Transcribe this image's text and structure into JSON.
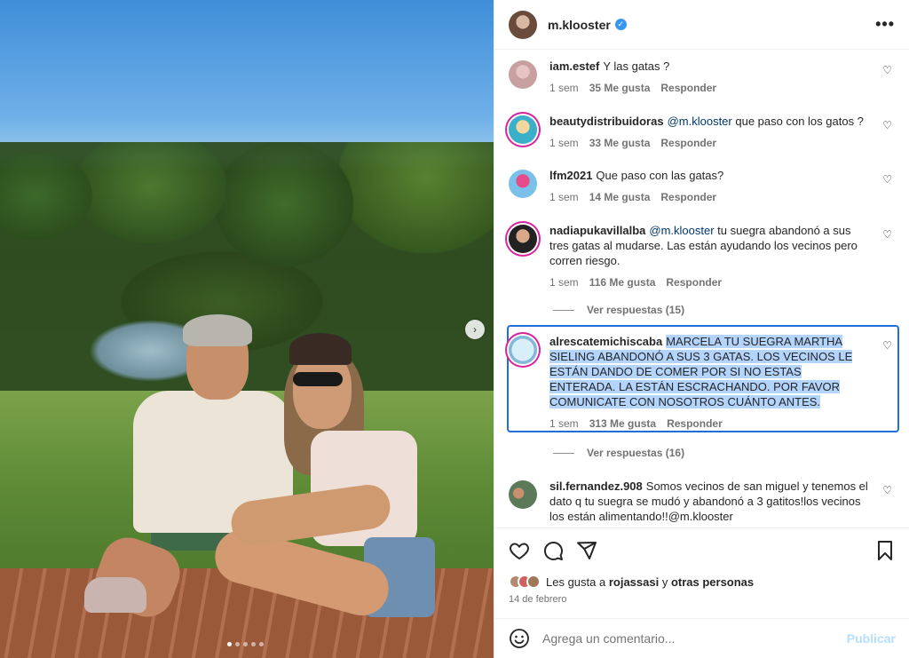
{
  "post": {
    "username": "m.klooster",
    "more_label": "•••",
    "next_label": "›"
  },
  "comments": [
    {
      "user": "iam.estef",
      "text": "Y las gatas ?",
      "time": "1 sem",
      "likes": "35 Me gusta",
      "reply": "Responder"
    },
    {
      "user": "beautydistribuidoras",
      "mention": "@m.klooster",
      "text": " que paso con los gatos ?",
      "time": "1 sem",
      "likes": "33 Me gusta",
      "reply": "Responder"
    },
    {
      "user": "lfm2021",
      "text": "Que paso con las gatas?",
      "time": "1 sem",
      "likes": "14 Me gusta",
      "reply": "Responder"
    },
    {
      "user": "nadiapukavillalba",
      "mention": "@m.klooster",
      "text": " tu suegra abandonó a sus tres gatas al mudarse. Las están ayudando los vecinos pero corren riesgo.",
      "time": "1 sem",
      "likes": "116 Me gusta",
      "reply": "Responder",
      "replies": "Ver respuestas (15)"
    },
    {
      "user": "alrescatemichiscaba",
      "text": "MARCELA TU SUEGRA MARTHA SIELING ABANDONÓ A SUS 3 GATAS. LOS VECINOS LE ESTÁN DANDO DE COMER POR SI NO ESTAS ENTERADA. LA ESTÁN ESCRACHANDO. POR FAVOR COMUNICATE CON NOSOTROS CUÁNTO ANTES.",
      "time": "1 sem",
      "likes": "313 Me gusta",
      "reply": "Responder",
      "replies": "Ver respuestas (16)"
    },
    {
      "user": "sil.fernandez.908",
      "text": "Somos vecinos de san miguel y tenemos el dato q tu suegra se mudó y abandonó a 3 gatitos!los vecinos los están alimentando!!@m.klooster"
    }
  ],
  "likes_bar": {
    "prefix": "Les gusta a ",
    "liker": "rojassasi",
    "middle": " y ",
    "others": "otras personas"
  },
  "date": "14 de febrero",
  "composer": {
    "placeholder": "Agrega un comentario...",
    "publish": "Publicar"
  },
  "colors": {
    "accent": "#0095f6",
    "publish_disabled": "#b2dffc",
    "mention": "#00376b",
    "selection": "#b3d4fc",
    "highlight_border": "#1f6fd6"
  }
}
